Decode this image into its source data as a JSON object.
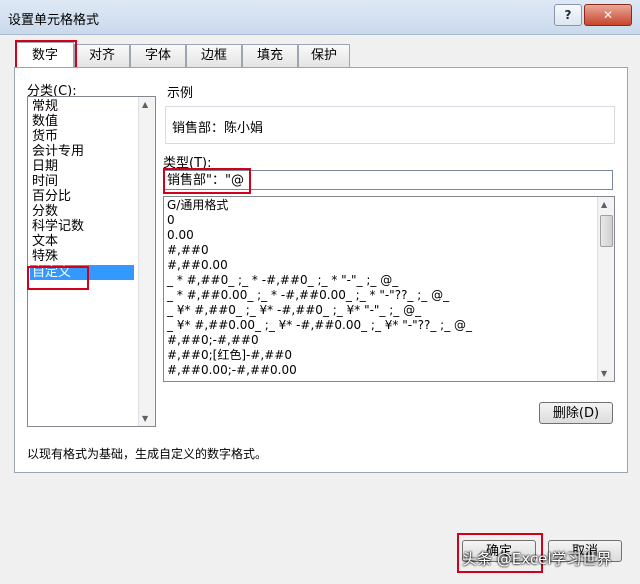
{
  "window": {
    "title": "设置单元格格式",
    "help_btn": "?",
    "close_btn": "✕"
  },
  "tabs": [
    {
      "label": "数字",
      "active": true
    },
    {
      "label": "对齐"
    },
    {
      "label": "字体"
    },
    {
      "label": "边框"
    },
    {
      "label": "填充"
    },
    {
      "label": "保护"
    }
  ],
  "category": {
    "label": "分类(C):",
    "items": [
      "常规",
      "数值",
      "货币",
      "会计专用",
      "日期",
      "时间",
      "百分比",
      "分数",
      "科学记数",
      "文本",
      "特殊",
      "自定义"
    ],
    "selected": "自定义"
  },
  "sample": {
    "label": "示例",
    "value": "销售部：陈小娟"
  },
  "type": {
    "label": "类型(T):",
    "value": "销售部\"：\"@",
    "list": [
      "G/通用格式",
      "0",
      "0.00",
      "#,##0",
      "#,##0.00",
      "_ * #,##0_ ;_ * -#,##0_ ;_ * \"-\"_ ;_ @_",
      "_ * #,##0.00_ ;_ * -#,##0.00_ ;_ * \"-\"??_ ;_ @_",
      "_ ¥* #,##0_ ;_ ¥* -#,##0_ ;_ ¥* \"-\"_ ;_ @_",
      "_ ¥* #,##0.00_ ;_ ¥* -#,##0.00_ ;_ ¥* \"-\"??_ ;_ @_",
      "#,##0;-#,##0",
      "#,##0;[红色]-#,##0",
      "#,##0.00;-#,##0.00"
    ]
  },
  "buttons": {
    "delete": "删除(D)",
    "ok": "确定",
    "cancel": "取消"
  },
  "description": "以现有格式为基础，生成自定义的数字格式。",
  "watermark": "头条 @Excel学习世界",
  "colors": {
    "highlight": "#d0021b",
    "selection": "#3399ff"
  }
}
